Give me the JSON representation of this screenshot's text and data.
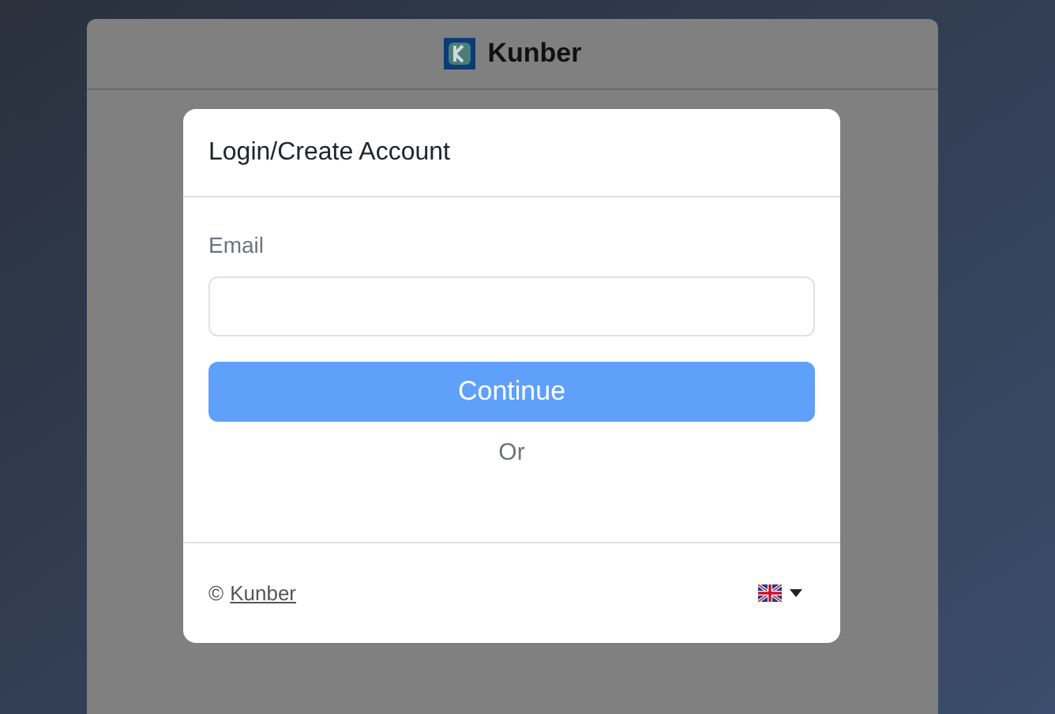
{
  "app_header": {
    "title": "Kunber"
  },
  "dialog": {
    "title": "Login/Create Account",
    "email": {
      "label": "Email"
    },
    "continue_button": "Continue",
    "separator": "Or",
    "footer": {
      "copyright": "©",
      "link": "Kunber"
    }
  }
}
